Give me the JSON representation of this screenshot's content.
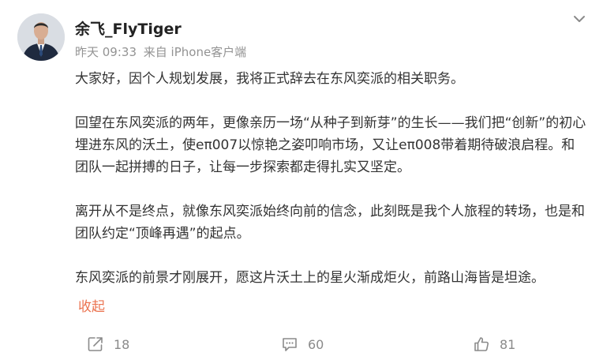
{
  "post": {
    "author": "余飞_FlyTiger",
    "time": "昨天 09:33",
    "source": "来自 iPhone客户端",
    "paragraphs": [
      "大家好，因个人规划发展，我将正式辞去在东风奕派的相关职务。",
      "回望在东风奕派的两年，更像亲历一场“从种子到新芽”的生长——我们把“创新”的初心埋进东风的沃土，使eπ007以惊艳之姿叩响市场，又让eπ008带着期待破浪启程。和团队一起拼搏的日子，让每一步探索都走得扎实又坚定。",
      "离开从不是终点，就像东风奕派始终向前的信念，此刻既是我个人旅程的转场，也是和团队约定“顶峰再遇”的起点。",
      "东风奕派的前景才刚展开，愿这片沃土上的星火渐成炬火，前路山海皆是坦途。"
    ],
    "collapse_label": "收起"
  },
  "actions": {
    "share_count": "18",
    "comment_count": "60",
    "like_count": "81"
  },
  "icons": {
    "menu": "chevron-down-icon",
    "share": "share-icon",
    "comment": "comment-icon",
    "like": "thumbs-up-icon"
  },
  "colors": {
    "collapse_link": "#eb7350",
    "meta_text": "#939393",
    "action_icon": "#8a8a8a"
  }
}
